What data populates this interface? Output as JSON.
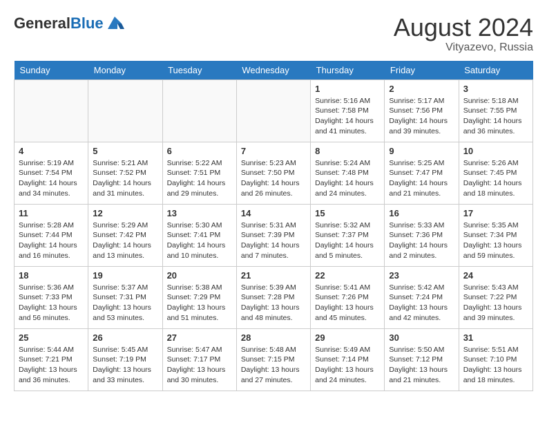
{
  "header": {
    "logo_general": "General",
    "logo_blue": "Blue",
    "month_year": "August 2024",
    "location": "Vityazevo, Russia"
  },
  "days_of_week": [
    "Sunday",
    "Monday",
    "Tuesday",
    "Wednesday",
    "Thursday",
    "Friday",
    "Saturday"
  ],
  "weeks": [
    [
      {
        "day": "",
        "info": ""
      },
      {
        "day": "",
        "info": ""
      },
      {
        "day": "",
        "info": ""
      },
      {
        "day": "",
        "info": ""
      },
      {
        "day": "1",
        "info": "Sunrise: 5:16 AM\nSunset: 7:58 PM\nDaylight: 14 hours\nand 41 minutes."
      },
      {
        "day": "2",
        "info": "Sunrise: 5:17 AM\nSunset: 7:56 PM\nDaylight: 14 hours\nand 39 minutes."
      },
      {
        "day": "3",
        "info": "Sunrise: 5:18 AM\nSunset: 7:55 PM\nDaylight: 14 hours\nand 36 minutes."
      }
    ],
    [
      {
        "day": "4",
        "info": "Sunrise: 5:19 AM\nSunset: 7:54 PM\nDaylight: 14 hours\nand 34 minutes."
      },
      {
        "day": "5",
        "info": "Sunrise: 5:21 AM\nSunset: 7:52 PM\nDaylight: 14 hours\nand 31 minutes."
      },
      {
        "day": "6",
        "info": "Sunrise: 5:22 AM\nSunset: 7:51 PM\nDaylight: 14 hours\nand 29 minutes."
      },
      {
        "day": "7",
        "info": "Sunrise: 5:23 AM\nSunset: 7:50 PM\nDaylight: 14 hours\nand 26 minutes."
      },
      {
        "day": "8",
        "info": "Sunrise: 5:24 AM\nSunset: 7:48 PM\nDaylight: 14 hours\nand 24 minutes."
      },
      {
        "day": "9",
        "info": "Sunrise: 5:25 AM\nSunset: 7:47 PM\nDaylight: 14 hours\nand 21 minutes."
      },
      {
        "day": "10",
        "info": "Sunrise: 5:26 AM\nSunset: 7:45 PM\nDaylight: 14 hours\nand 18 minutes."
      }
    ],
    [
      {
        "day": "11",
        "info": "Sunrise: 5:28 AM\nSunset: 7:44 PM\nDaylight: 14 hours\nand 16 minutes."
      },
      {
        "day": "12",
        "info": "Sunrise: 5:29 AM\nSunset: 7:42 PM\nDaylight: 14 hours\nand 13 minutes."
      },
      {
        "day": "13",
        "info": "Sunrise: 5:30 AM\nSunset: 7:41 PM\nDaylight: 14 hours\nand 10 minutes."
      },
      {
        "day": "14",
        "info": "Sunrise: 5:31 AM\nSunset: 7:39 PM\nDaylight: 14 hours\nand 7 minutes."
      },
      {
        "day": "15",
        "info": "Sunrise: 5:32 AM\nSunset: 7:37 PM\nDaylight: 14 hours\nand 5 minutes."
      },
      {
        "day": "16",
        "info": "Sunrise: 5:33 AM\nSunset: 7:36 PM\nDaylight: 14 hours\nand 2 minutes."
      },
      {
        "day": "17",
        "info": "Sunrise: 5:35 AM\nSunset: 7:34 PM\nDaylight: 13 hours\nand 59 minutes."
      }
    ],
    [
      {
        "day": "18",
        "info": "Sunrise: 5:36 AM\nSunset: 7:33 PM\nDaylight: 13 hours\nand 56 minutes."
      },
      {
        "day": "19",
        "info": "Sunrise: 5:37 AM\nSunset: 7:31 PM\nDaylight: 13 hours\nand 53 minutes."
      },
      {
        "day": "20",
        "info": "Sunrise: 5:38 AM\nSunset: 7:29 PM\nDaylight: 13 hours\nand 51 minutes."
      },
      {
        "day": "21",
        "info": "Sunrise: 5:39 AM\nSunset: 7:28 PM\nDaylight: 13 hours\nand 48 minutes."
      },
      {
        "day": "22",
        "info": "Sunrise: 5:41 AM\nSunset: 7:26 PM\nDaylight: 13 hours\nand 45 minutes."
      },
      {
        "day": "23",
        "info": "Sunrise: 5:42 AM\nSunset: 7:24 PM\nDaylight: 13 hours\nand 42 minutes."
      },
      {
        "day": "24",
        "info": "Sunrise: 5:43 AM\nSunset: 7:22 PM\nDaylight: 13 hours\nand 39 minutes."
      }
    ],
    [
      {
        "day": "25",
        "info": "Sunrise: 5:44 AM\nSunset: 7:21 PM\nDaylight: 13 hours\nand 36 minutes."
      },
      {
        "day": "26",
        "info": "Sunrise: 5:45 AM\nSunset: 7:19 PM\nDaylight: 13 hours\nand 33 minutes."
      },
      {
        "day": "27",
        "info": "Sunrise: 5:47 AM\nSunset: 7:17 PM\nDaylight: 13 hours\nand 30 minutes."
      },
      {
        "day": "28",
        "info": "Sunrise: 5:48 AM\nSunset: 7:15 PM\nDaylight: 13 hours\nand 27 minutes."
      },
      {
        "day": "29",
        "info": "Sunrise: 5:49 AM\nSunset: 7:14 PM\nDaylight: 13 hours\nand 24 minutes."
      },
      {
        "day": "30",
        "info": "Sunrise: 5:50 AM\nSunset: 7:12 PM\nDaylight: 13 hours\nand 21 minutes."
      },
      {
        "day": "31",
        "info": "Sunrise: 5:51 AM\nSunset: 7:10 PM\nDaylight: 13 hours\nand 18 minutes."
      }
    ]
  ]
}
